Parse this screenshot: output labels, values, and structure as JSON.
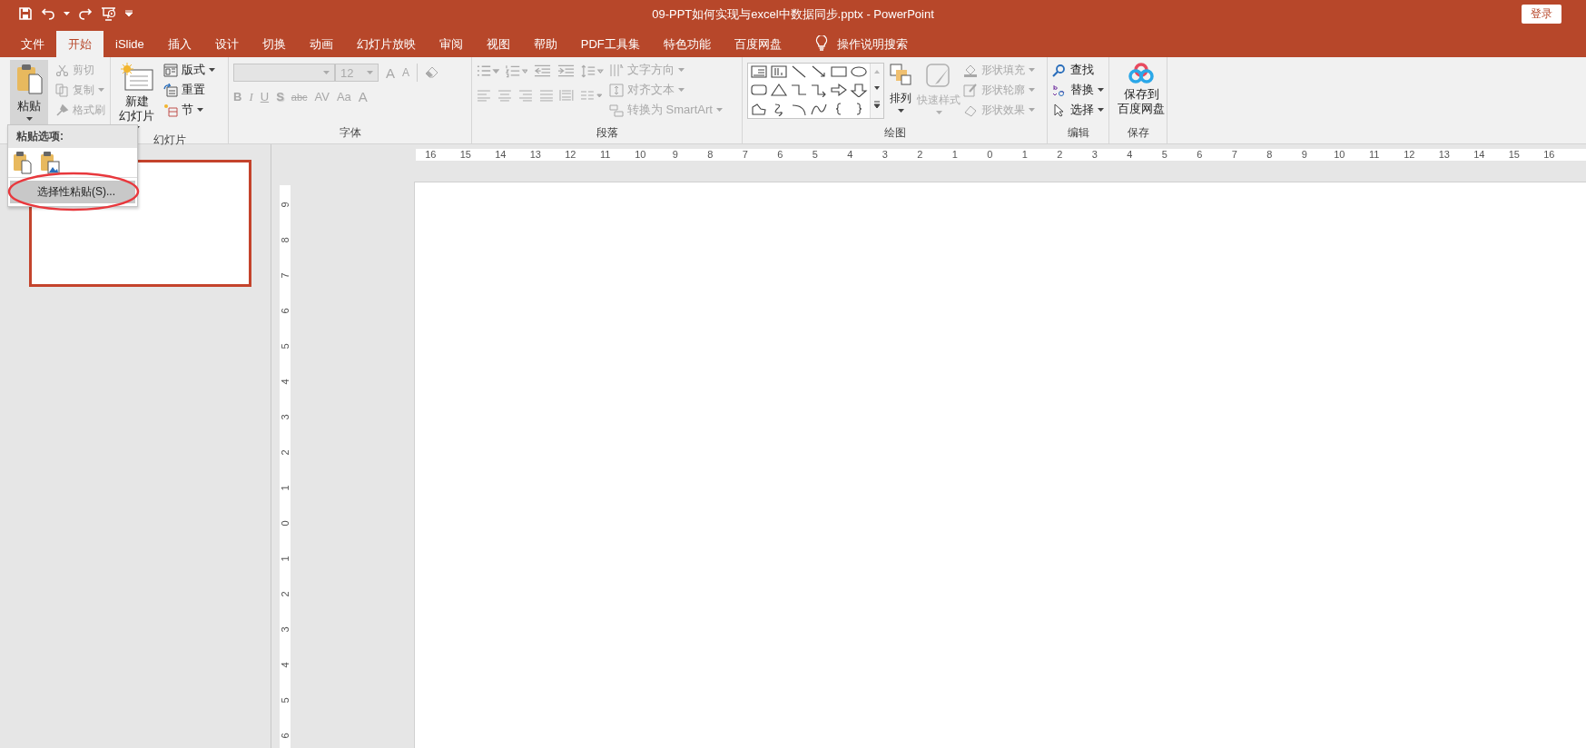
{
  "window": {
    "title": "09-PPT如何实现与excel中数据同步.pptx  -  PowerPoint",
    "sign_in": "登录"
  },
  "tabs": [
    {
      "label": "文件",
      "selected": false
    },
    {
      "label": "开始",
      "selected": true
    },
    {
      "label": "iSlide",
      "selected": false
    },
    {
      "label": "插入",
      "selected": false
    },
    {
      "label": "设计",
      "selected": false
    },
    {
      "label": "切换",
      "selected": false
    },
    {
      "label": "动画",
      "selected": false
    },
    {
      "label": "幻灯片放映",
      "selected": false
    },
    {
      "label": "审阅",
      "selected": false
    },
    {
      "label": "视图",
      "selected": false
    },
    {
      "label": "帮助",
      "selected": false
    },
    {
      "label": "PDF工具集",
      "selected": false
    },
    {
      "label": "特色功能",
      "selected": false
    },
    {
      "label": "百度网盘",
      "selected": false
    }
  ],
  "tell_me": "操作说明搜索",
  "clipboard": {
    "paste": "粘贴",
    "items": [
      {
        "kind": "cut",
        "label": "剪切",
        "disabled": true
      },
      {
        "kind": "copy",
        "label": "复制",
        "disabled": true
      },
      {
        "kind": "format-painter",
        "label": "格式刷",
        "disabled": true
      }
    ]
  },
  "slides": {
    "label": "幻灯片",
    "new_slide": [
      "新建",
      "幻灯片"
    ],
    "items": [
      {
        "kind": "layout",
        "label": "版式"
      },
      {
        "kind": "reset",
        "label": "重置"
      },
      {
        "kind": "section",
        "label": "节"
      }
    ]
  },
  "font": {
    "label": "字体",
    "size": "12",
    "size_buttons": [
      "A",
      "A"
    ],
    "buttons": [
      "B",
      "I",
      "U",
      "S",
      "abc",
      "AV",
      "Aa",
      "A"
    ]
  },
  "paragraph": {
    "label": "段落",
    "items": [
      {
        "kind": "text-direction",
        "label": "文字方向",
        "disabled": true
      },
      {
        "kind": "align-text",
        "label": "对齐文本",
        "disabled": true
      },
      {
        "kind": "smartart",
        "label": "转换为 SmartArt",
        "disabled": true
      }
    ]
  },
  "drawing": {
    "label": "绘图",
    "arrange": "排列",
    "quick_styles": {
      "label": "快速样式",
      "disabled": true
    },
    "items": [
      {
        "kind": "fill",
        "label": "形状填充",
        "disabled": true
      },
      {
        "kind": "outline",
        "label": "形状轮廓",
        "disabled": true
      },
      {
        "kind": "effects",
        "label": "形状效果",
        "disabled": true
      }
    ]
  },
  "editing": {
    "label": "编辑",
    "items": [
      {
        "kind": "find",
        "label": "查找"
      },
      {
        "kind": "replace",
        "label": "替换"
      },
      {
        "kind": "select",
        "label": "选择"
      }
    ]
  },
  "save": {
    "label": "保存",
    "button": [
      "保存到",
      "百度网盘"
    ]
  },
  "paste_menu": {
    "header": "粘贴选项:",
    "items": [
      {
        "label": "选择性粘贴(S)...",
        "selected": true
      }
    ]
  },
  "thumbnails": [
    {
      "selected": true
    }
  ],
  "rulers": {
    "horizontal": [
      "16",
      "15",
      "14",
      "13",
      "12",
      "11",
      "10",
      "9",
      "8",
      "7",
      "6",
      "5",
      "4",
      "3",
      "2",
      "1",
      "0",
      "1",
      "2",
      "3",
      "4",
      "5",
      "6",
      "7",
      "8",
      "9",
      "10",
      "11",
      "12",
      "13",
      "14",
      "15",
      "16"
    ],
    "vertical": [
      "9",
      "8",
      "7",
      "6",
      "5",
      "4",
      "3",
      "2",
      "1",
      "0",
      "1",
      "2",
      "3",
      "4",
      "5",
      "6"
    ]
  }
}
